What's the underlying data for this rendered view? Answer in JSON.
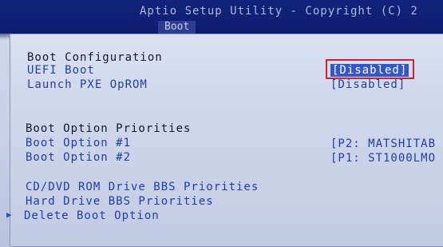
{
  "header": {
    "title": "Aptio Setup Utility - Copyright (C) 2",
    "tabs": [
      {
        "label": "Boot",
        "active": true
      }
    ]
  },
  "main": {
    "boot_configuration": {
      "heading": "Boot Configuration",
      "settings": [
        {
          "label": "UEFI Boot",
          "value": "[Disabled]"
        },
        {
          "label": "Launch PXE OpROM",
          "value": "[Disabled]"
        }
      ]
    },
    "boot_option_priorities": {
      "heading": "Boot Option Priorities",
      "settings": [
        {
          "label": "Boot Option #1",
          "value": "[P2: MATSHITAB"
        },
        {
          "label": "Boot Option #2",
          "value": "[P1: ST1000LMO"
        }
      ]
    },
    "submenus": [
      {
        "label": "CD/DVD ROM Drive BBS Priorities"
      },
      {
        "label": "Hard Drive BBS Priorities"
      },
      {
        "label": "Delete Boot Option"
      }
    ]
  },
  "colors": {
    "header_background": "#0d1c6d",
    "panel_background": "#d0d8ec",
    "option_text": "#1f3fa8",
    "heading_text": "#14182e",
    "highlight_box": "#d11f35"
  },
  "icons": {
    "submenu_pointer": "submenu-arrow-icon"
  }
}
